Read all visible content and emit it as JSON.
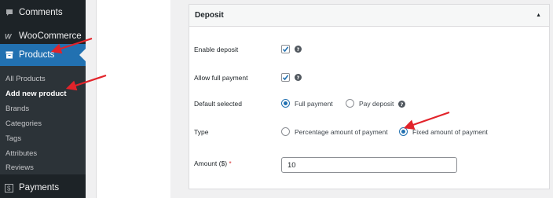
{
  "sidebar": {
    "comments": "Comments",
    "woocommerce": "WooCommerce",
    "products": "Products",
    "payments": "Payments",
    "submenu": [
      {
        "label": "All Products"
      },
      {
        "label": "Add new product"
      },
      {
        "label": "Brands"
      },
      {
        "label": "Categories"
      },
      {
        "label": "Tags"
      },
      {
        "label": "Attributes"
      },
      {
        "label": "Reviews"
      }
    ]
  },
  "panel": {
    "title": "Deposit",
    "help_glyph": "?",
    "enable_deposit": {
      "label": "Enable deposit",
      "checked": true
    },
    "allow_full_payment": {
      "label": "Allow full payment",
      "checked": true
    },
    "default_selected": {
      "label": "Default selected",
      "options": [
        "Full payment",
        "Pay deposit"
      ],
      "selected": "Full payment"
    },
    "type": {
      "label": "Type",
      "options": [
        "Percentage amount of payment",
        "Fixed amount of payment"
      ],
      "selected": "Fixed amount of payment"
    },
    "amount": {
      "label": "Amount ($)",
      "required_mark": "*",
      "value": "10"
    }
  },
  "colors": {
    "sidebar_bg": "#1d2327",
    "accent": "#2271b1",
    "annotation_arrow": "#e2232a",
    "required": "#d63638"
  }
}
